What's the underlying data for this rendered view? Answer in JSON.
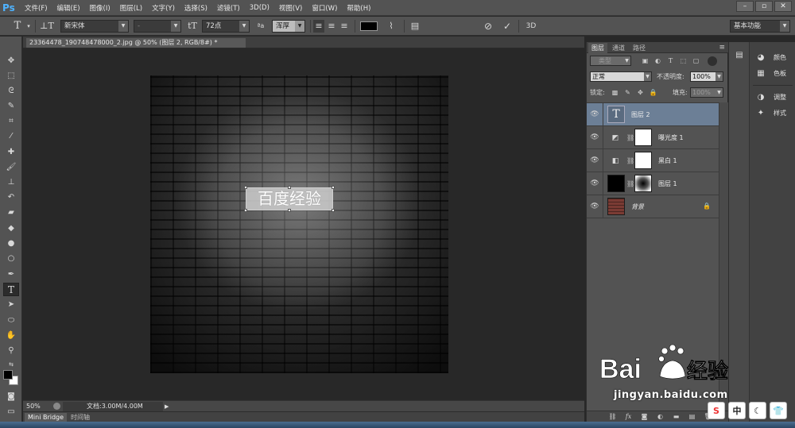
{
  "app": {
    "logo": "Ps",
    "menu": [
      "文件(F)",
      "编辑(E)",
      "图像(I)",
      "图层(L)",
      "文字(Y)",
      "选择(S)",
      "滤镜(T)",
      "3D(D)",
      "视图(V)",
      "窗口(W)",
      "帮助(H)"
    ],
    "window_controls": [
      "–",
      "▫",
      "✕"
    ]
  },
  "options_bar": {
    "font_family": "新宋体",
    "font_style": "-",
    "font_size": "72点",
    "antialias": "浑厚",
    "text_color": "#000000",
    "workspace": "基本功能",
    "label_3d": "3D"
  },
  "document": {
    "tab_title": "23364478_190748478000_2.jpg @ 50% (图层 2, RGB/8#) *",
    "canvas_text": "百度经验",
    "zoom": "50%",
    "doc_info": "文档:3.00M/4.00M"
  },
  "bottom_tabs": [
    "Mini Bridge",
    "时间轴"
  ],
  "layers_panel": {
    "tabs": [
      "图层",
      "通道",
      "路径"
    ],
    "filter_kind": "类型",
    "blend_mode": "正常",
    "opacity_label": "不透明度:",
    "opacity_value": "100%",
    "lock_label": "锁定:",
    "fill_label": "填充:",
    "fill_value": "100%",
    "layers": [
      {
        "name": "图层 2",
        "kind": "text",
        "selected": true
      },
      {
        "name": "曝光度 1",
        "kind": "adjustment-exposure",
        "selected": false
      },
      {
        "name": "黑白 1",
        "kind": "adjustment-bw",
        "selected": false
      },
      {
        "name": "图层 1",
        "kind": "masked",
        "selected": false
      },
      {
        "name": "背景",
        "kind": "background",
        "selected": false
      }
    ]
  },
  "dock": {
    "items": [
      {
        "label": "颜色",
        "icon": "color-icon"
      },
      {
        "label": "色板",
        "icon": "swatches-icon"
      },
      {
        "label": "调整",
        "icon": "adjustments-icon"
      },
      {
        "label": "样式",
        "icon": "styles-icon"
      }
    ]
  },
  "watermark": {
    "url": "jingyan.baidu.com"
  },
  "tray": [
    "S",
    "中"
  ],
  "colors": {
    "chrome": "#535353",
    "selected_layer": "#6c7f96",
    "ps_blue": "#4fb3ff"
  }
}
